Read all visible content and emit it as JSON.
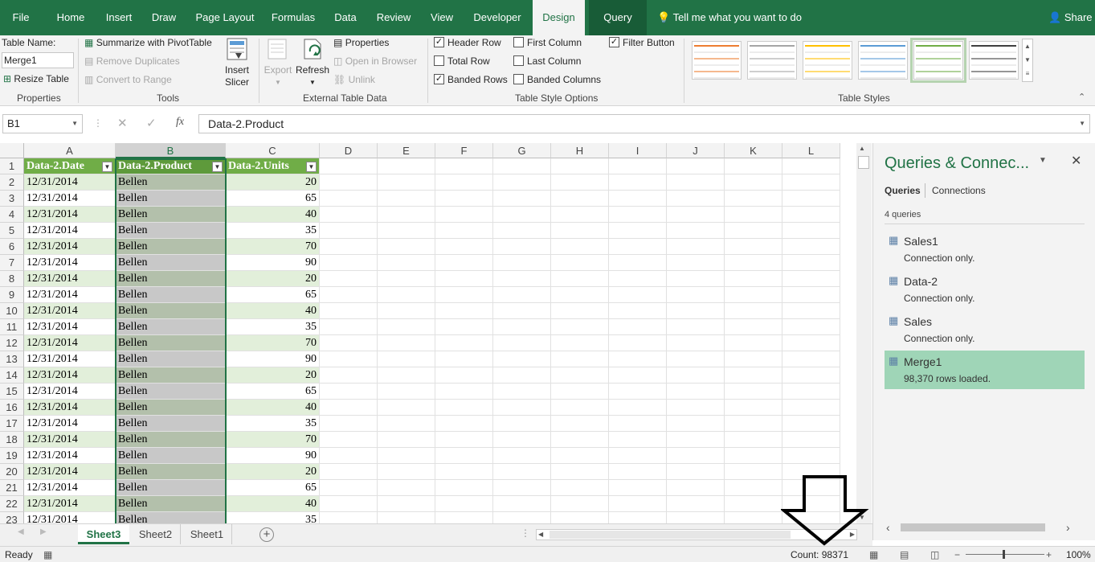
{
  "tabs": [
    "File",
    "Home",
    "Insert",
    "Draw",
    "Page Layout",
    "Formulas",
    "Data",
    "Review",
    "View",
    "Developer",
    "Design",
    "Query"
  ],
  "tell_me": "Tell me what you want to do",
  "share": "Share",
  "ribbon": {
    "properties": {
      "table_name_label": "Table Name:",
      "table_name_value": "Merge1",
      "resize_label": "Resize Table",
      "group": "Properties"
    },
    "tools": {
      "summarize": "Summarize with PivotTable",
      "remove_duplicates": "Remove Duplicates",
      "convert": "Convert to Range",
      "insert_slicer_1": "Insert",
      "insert_slicer_2": "Slicer",
      "group": "Tools"
    },
    "external": {
      "export": "Export",
      "refresh": "Refresh",
      "properties": "Properties",
      "open_browser": "Open in Browser",
      "unlink": "Unlink",
      "group": "External Table Data"
    },
    "style_options": {
      "header_row": "Header Row",
      "total_row": "Total Row",
      "banded_rows": "Banded Rows",
      "first_column": "First Column",
      "last_column": "Last Column",
      "banded_columns": "Banded Columns",
      "filter_button": "Filter Button",
      "group": "Table Style Options"
    },
    "table_styles": {
      "group": "Table Styles",
      "swatches": [
        "#ed7d31",
        "#a5a5a5",
        "#ffc000",
        "#5b9bd5",
        "#70ad47",
        "#404040"
      ]
    }
  },
  "formula_bar": {
    "name_box": "B1",
    "fx": "fx",
    "formula": "Data-2.Product"
  },
  "columns": [
    "A",
    "B",
    "C",
    "D",
    "E",
    "F",
    "G",
    "H",
    "I",
    "J",
    "K",
    "L"
  ],
  "table": {
    "headers": [
      "Data-2.Date",
      "Data-2.Product",
      "Data-2.Units"
    ],
    "rows": [
      [
        "12/31/2014",
        "Bellen",
        "20"
      ],
      [
        "12/31/2014",
        "Bellen",
        "65"
      ],
      [
        "12/31/2014",
        "Bellen",
        "40"
      ],
      [
        "12/31/2014",
        "Bellen",
        "35"
      ],
      [
        "12/31/2014",
        "Bellen",
        "70"
      ],
      [
        "12/31/2014",
        "Bellen",
        "90"
      ],
      [
        "12/31/2014",
        "Bellen",
        "20"
      ],
      [
        "12/31/2014",
        "Bellen",
        "65"
      ],
      [
        "12/31/2014",
        "Bellen",
        "40"
      ],
      [
        "12/31/2014",
        "Bellen",
        "35"
      ],
      [
        "12/31/2014",
        "Bellen",
        "70"
      ],
      [
        "12/31/2014",
        "Bellen",
        "90"
      ],
      [
        "12/31/2014",
        "Bellen",
        "20"
      ],
      [
        "12/31/2014",
        "Bellen",
        "65"
      ],
      [
        "12/31/2014",
        "Bellen",
        "40"
      ],
      [
        "12/31/2014",
        "Bellen",
        "35"
      ],
      [
        "12/31/2014",
        "Bellen",
        "70"
      ],
      [
        "12/31/2014",
        "Bellen",
        "90"
      ],
      [
        "12/31/2014",
        "Bellen",
        "20"
      ],
      [
        "12/31/2014",
        "Bellen",
        "65"
      ],
      [
        "12/31/2014",
        "Bellen",
        "40"
      ],
      [
        "12/31/2014",
        "Bellen",
        "35"
      ]
    ]
  },
  "panel": {
    "title": "Queries & Connec...",
    "tab_queries": "Queries",
    "tab_connections": "Connections",
    "count": "4 queries",
    "queries": [
      {
        "name": "Sales1",
        "status": "Connection only."
      },
      {
        "name": "Data-2",
        "status": "Connection only."
      },
      {
        "name": "Sales",
        "status": "Connection only."
      },
      {
        "name": "Merge1",
        "status": "98,370 rows loaded."
      }
    ]
  },
  "sheets": [
    "Sheet3",
    "Sheet2",
    "Sheet1"
  ],
  "status": {
    "ready": "Ready",
    "count": "Count: 98371",
    "zoom": "100%"
  }
}
